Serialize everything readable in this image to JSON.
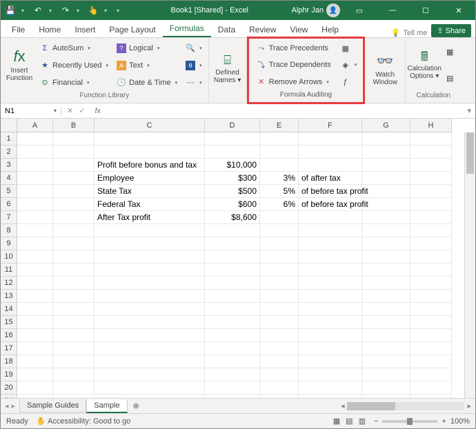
{
  "titlebar": {
    "doc": "Book1  [Shared]  -  Excel",
    "user": "Alphr Jan"
  },
  "tabs": {
    "items": [
      "File",
      "Home",
      "Insert",
      "Page Layout",
      "Formulas",
      "Data",
      "Review",
      "View",
      "Help"
    ],
    "active": 4,
    "tell": "Tell me",
    "share": "Share"
  },
  "ribbon": {
    "insertfn": {
      "line1": "Insert",
      "line2": "Function"
    },
    "lib": {
      "label": "Function Library",
      "col1": [
        "AutoSum",
        "Recently Used",
        "Financial"
      ],
      "col2": [
        "Logical",
        "Text",
        "Date & Time"
      ]
    },
    "names": {
      "label": "",
      "btn1": "Defined",
      "btn2": "Names"
    },
    "audit": {
      "label": "Formula Auditing",
      "a": "Trace Precedents",
      "b": "Trace Dependents",
      "c": "Remove Arrows"
    },
    "watch": {
      "line1": "Watch",
      "line2": "Window"
    },
    "calc": {
      "label": "Calculation",
      "line1": "Calculation",
      "line2": "Options"
    }
  },
  "namebox": "N1",
  "cols": [
    "A",
    "B",
    "C",
    "D",
    "E",
    "F",
    "G",
    "H"
  ],
  "rows": [
    3,
    4,
    5,
    6,
    7
  ],
  "cells": {
    "C3": "Profit before bonus and tax",
    "D3": "$10,000",
    "C4": "Employee",
    "D4": "$300",
    "E4": "3%",
    "F4": "of after tax",
    "C5": "State Tax",
    "D5": "$500",
    "E5": "5%",
    "F5": "of before tax profit",
    "C6": "Federal Tax",
    "D6": "$600",
    "E6": "6%",
    "F6": "of before tax profit",
    "C7": "After Tax profit",
    "D7": "$8,600"
  },
  "sheets": {
    "items": [
      "Sample Guides",
      "Sample"
    ],
    "active": 1
  },
  "status": {
    "ready": "Ready",
    "access": "Accessibility: Good to go",
    "zoom": "100%"
  }
}
